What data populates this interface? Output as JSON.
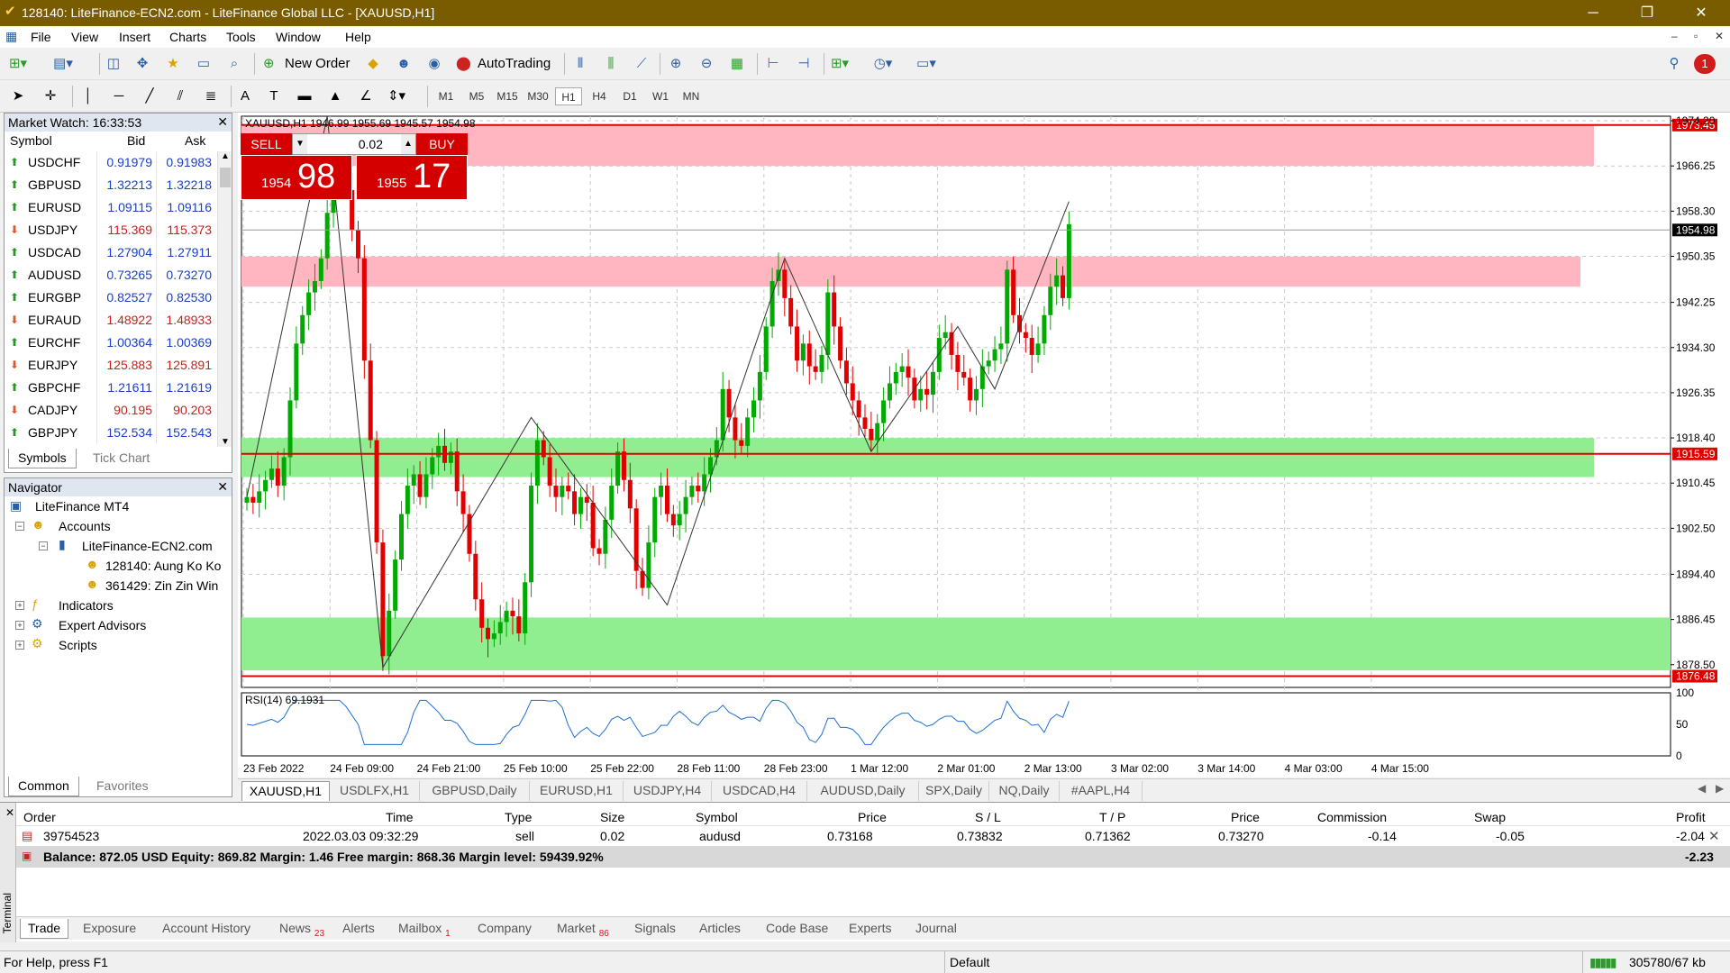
{
  "titlebar": {
    "title": "128140: LiteFinance-ECN2.com - LiteFinance Global LLC - [XAUUSD,H1]",
    "minimize": "─",
    "restore": "❐",
    "close": "✕"
  },
  "menu": {
    "items": [
      "File",
      "View",
      "Insert",
      "Charts",
      "Tools",
      "Window",
      "Help"
    ],
    "child_min": "–",
    "child_restore": "▫",
    "child_close": "✕"
  },
  "toolbar": {
    "new_order": "New Order",
    "autotrading": "AutoTrading",
    "notification_count": "1"
  },
  "timeframes": [
    "M1",
    "M5",
    "M15",
    "M30",
    "H1",
    "H4",
    "D1",
    "W1",
    "MN"
  ],
  "active_timeframe": "H1",
  "market_watch": {
    "title": "Market Watch: 16:33:53",
    "col_symbol": "Symbol",
    "col_bid": "Bid",
    "col_ask": "Ask",
    "rows": [
      {
        "symbol": "USDCHF",
        "bid": "0.91979",
        "ask": "0.91983",
        "dir": "up"
      },
      {
        "symbol": "GBPUSD",
        "bid": "1.32213",
        "ask": "1.32218",
        "dir": "up"
      },
      {
        "symbol": "EURUSD",
        "bid": "1.09115",
        "ask": "1.09116",
        "dir": "up"
      },
      {
        "symbol": "USDJPY",
        "bid": "115.369",
        "ask": "115.373",
        "dir": "dn"
      },
      {
        "symbol": "USDCAD",
        "bid": "1.27904",
        "ask": "1.27911",
        "dir": "up"
      },
      {
        "symbol": "AUDUSD",
        "bid": "0.73265",
        "ask": "0.73270",
        "dir": "up"
      },
      {
        "symbol": "EURGBP",
        "bid": "0.82527",
        "ask": "0.82530",
        "dir": "up"
      },
      {
        "symbol": "EURAUD",
        "bid": "1.48922",
        "ask": "1.48933",
        "dir": "dn"
      },
      {
        "symbol": "EURCHF",
        "bid": "1.00364",
        "ask": "1.00369",
        "dir": "up"
      },
      {
        "symbol": "EURJPY",
        "bid": "125.883",
        "ask": "125.891",
        "dir": "dn"
      },
      {
        "symbol": "GBPCHF",
        "bid": "1.21611",
        "ask": "1.21619",
        "dir": "up"
      },
      {
        "symbol": "CADJPY",
        "bid": "90.195",
        "ask": "90.203",
        "dir": "dn"
      },
      {
        "symbol": "GBPJPY",
        "bid": "152.534",
        "ask": "152.543",
        "dir": "up"
      }
    ],
    "tabs": [
      "Symbols",
      "Tick Chart"
    ]
  },
  "navigator": {
    "title": "Navigator",
    "root": "LiteFinance MT4",
    "accounts": "Accounts",
    "server": "LiteFinance-ECN2.com",
    "account1": "128140: Aung Ko Ko",
    "account2": "361429: Zin Zin Win",
    "indicators": "Indicators",
    "experts": "Expert Advisors",
    "scripts": "Scripts",
    "tabs": [
      "Common",
      "Favorites"
    ]
  },
  "chart": {
    "header": "XAUUSD,H1  1946.99 1955.69 1945.57 1954.98",
    "rsi_label": "RSI(14) 69.1931",
    "sell_label": "SELL",
    "buy_label": "BUY",
    "lot": "0.02",
    "sell_small": "1954",
    "sell_big": "98",
    "buy_small": "1955",
    "buy_big": "17",
    "current_price": "1954.98",
    "line_upper": "1973.45",
    "line_mid": "1915.59",
    "line_lower": "1876.48",
    "colors": {
      "bull": "#00aa00",
      "bear": "#e00000",
      "resistance": "#ffb6c1",
      "support": "#90ee90",
      "hline": "#e00000",
      "rsi": "#1f6fd0"
    }
  },
  "chart_data": {
    "type": "candlestick",
    "symbol": "XAUUSD",
    "timeframe": "H1",
    "y_ticks": [
      "1974.20",
      "1966.25",
      "1958.30",
      "1950.35",
      "1942.25",
      "1934.30",
      "1926.35",
      "1918.40",
      "1910.45",
      "1902.50",
      "1894.40",
      "1886.45",
      "1878.50"
    ],
    "x_ticks": [
      "23 Feb 2022",
      "24 Feb 09:00",
      "24 Feb 21:00",
      "25 Feb 10:00",
      "25 Feb 22:00",
      "28 Feb 11:00",
      "28 Feb 23:00",
      "1 Mar 12:00",
      "2 Mar 01:00",
      "2 Mar 13:00",
      "3 Mar 02:00",
      "3 Mar 14:00",
      "4 Mar 03:00",
      "4 Mar 15:00"
    ],
    "ylim": [
      1874.5,
      1975
    ],
    "closes": [
      1908,
      1907,
      1909,
      1911,
      1913,
      1910,
      1915,
      1925,
      1935,
      1940,
      1944,
      1946,
      1950,
      1958,
      1968,
      1964,
      1962,
      1955,
      1950,
      1932,
      1918,
      1900,
      1880,
      1888,
      1897,
      1905,
      1910,
      1912,
      1908,
      1912,
      1915,
      1917,
      1914,
      1916,
      1909,
      1905,
      1898,
      1890,
      1885,
      1883,
      1884,
      1886,
      1888,
      1887,
      1884,
      1893,
      1910,
      1918,
      1915,
      1910,
      1908,
      1910,
      1909,
      1905,
      1908,
      1907,
      1899,
      1898,
      1904,
      1910,
      1916,
      1911,
      1906,
      1895,
      1892,
      1900,
      1908,
      1910,
      1905,
      1903,
      1905,
      1908,
      1910,
      1909,
      1912,
      1915,
      1918,
      1927,
      1922,
      1918,
      1917,
      1922,
      1925,
      1930,
      1938,
      1946,
      1948,
      1943,
      1938,
      1932,
      1935,
      1931,
      1930,
      1933,
      1944,
      1938,
      1932,
      1928,
      1925,
      1922,
      1920,
      1918,
      1921,
      1925,
      1928,
      1930,
      1931,
      1929,
      1925,
      1927,
      1926,
      1930,
      1936,
      1937,
      1933,
      1930,
      1929,
      1925,
      1927,
      1931,
      1932,
      1934,
      1935,
      1948,
      1940,
      1937,
      1936,
      1933,
      1935,
      1940,
      1945,
      1947,
      1943,
      1956
    ],
    "h_lines": [
      1973.45,
      1915.59,
      1876.48
    ],
    "zones": [
      {
        "from": 1966.25,
        "to": 1973.45,
        "type": "resistance"
      },
      {
        "from": 1945.0,
        "to": 1950.3,
        "type": "resistance"
      },
      {
        "from": 1911.5,
        "to": 1918.4,
        "type": "support"
      },
      {
        "from": 1877.5,
        "to": 1886.8,
        "type": "support"
      }
    ],
    "rsi": {
      "name": "RSI(14)",
      "value": 69.1931,
      "ylim": [
        0,
        100
      ],
      "ticks": [
        "100",
        "50",
        "0"
      ]
    }
  },
  "chart_tabs": [
    "XAUUSD,H1",
    "USDLFX,H1",
    "GBPUSD,Daily",
    "EURUSD,H1",
    "USDJPY,H4",
    "USDCAD,H4",
    "AUDUSD,Daily",
    "SPX,Daily",
    "NQ,Daily",
    "#AAPL,H4"
  ],
  "terminal": {
    "side_label": "Terminal",
    "headers": [
      "Order",
      "Time",
      "Type",
      "Size",
      "Symbol",
      "Price",
      "S / L",
      "T / P",
      "Price",
      "Commission",
      "Swap",
      "Profit"
    ],
    "order": {
      "id": "39754523",
      "time": "2022.03.03 09:32:29",
      "type": "sell",
      "size": "0.02",
      "symbol": "audusd",
      "price": "0.73168",
      "sl": "0.73832",
      "tp": "0.71362",
      "cur_price": "0.73270",
      "commission": "-0.14",
      "swap": "-0.05",
      "profit": "-2.04"
    },
    "balance_line": "Balance: 872.05 USD  Equity: 869.82  Margin: 1.46  Free margin: 868.36  Margin level: 59439.92%",
    "total_profit": "-2.23",
    "tabs": [
      {
        "label": "Trade",
        "badge": ""
      },
      {
        "label": "Exposure",
        "badge": ""
      },
      {
        "label": "Account History",
        "badge": ""
      },
      {
        "label": "News",
        "badge": "23"
      },
      {
        "label": "Alerts",
        "badge": ""
      },
      {
        "label": "Mailbox",
        "badge": "1"
      },
      {
        "label": "Company",
        "badge": ""
      },
      {
        "label": "Market",
        "badge": "86"
      },
      {
        "label": "Signals",
        "badge": ""
      },
      {
        "label": "Articles",
        "badge": ""
      },
      {
        "label": "Code Base",
        "badge": ""
      },
      {
        "label": "Experts",
        "badge": ""
      },
      {
        "label": "Journal",
        "badge": ""
      }
    ]
  },
  "statusbar": {
    "help": "For Help, press F1",
    "profile": "Default",
    "traffic": "305780/67 kb"
  }
}
